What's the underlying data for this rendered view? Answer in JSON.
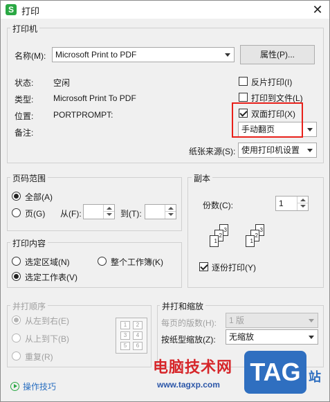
{
  "window": {
    "title": "打印",
    "icon_letter": "S",
    "close_glyph": "✕"
  },
  "printer": {
    "group_title": "打印机",
    "name_label": "名称(M):",
    "name_value": "Microsoft Print to PDF",
    "properties_button": "属性(P)...",
    "status_label": "状态:",
    "status_value": "空闲",
    "type_label": "类型:",
    "type_value": "Microsoft Print To PDF",
    "location_label": "位置:",
    "location_value": "PORTPROMPT:",
    "comment_label": "备注:",
    "reverse_print": {
      "label": "反片打印(I)",
      "checked": false
    },
    "print_to_file": {
      "label": "打印到文件(L)",
      "checked": false
    },
    "duplex": {
      "label": "双面打印(X)",
      "checked": true
    },
    "duplex_mode": "手动翻页",
    "paper_source_label": "纸张来源(S):",
    "paper_source_value": "使用打印机设置"
  },
  "page_range": {
    "group_title": "页码范围",
    "all_label": "全部(A)",
    "pages_label": "页(G)",
    "from_label": "从(F):",
    "to_label": "到(T):"
  },
  "copies": {
    "group_title": "副本",
    "count_label": "份数(C):",
    "count_value": "1",
    "collate": {
      "label": "逐份打印(Y)",
      "checked": true
    },
    "page_numbers": [
      "1",
      "2",
      "3"
    ]
  },
  "print_content": {
    "group_title": "打印内容",
    "selection_label": "选定区域(N)",
    "workbook_label": "整个工作簿(K)",
    "sheet_label": "选定工作表(V)"
  },
  "print_order": {
    "group_title": "并打顺序",
    "left_to_right": "从左到右(E)",
    "top_to_bottom": "从上到下(B)",
    "repeat": "重复(R)",
    "grid_numbers": [
      "1",
      "2",
      "3",
      "4",
      "5",
      "6"
    ]
  },
  "scaling": {
    "group_title": "并打和缩放",
    "pages_per_sheet_label": "每页的版数(H):",
    "pages_per_sheet_value": "1 版",
    "scale_label": "按纸型缩放(Z):",
    "scale_value": "无缩放"
  },
  "footer": {
    "tips_link": "操作技巧"
  },
  "watermark": {
    "site_name": "电脑技术网",
    "url": "www.tagxp.com",
    "logo": "TAG",
    "suffix": "站"
  },
  "colors": {
    "accent_green": "#2aa843",
    "highlight_red": "#e8201a",
    "link_blue": "#2a6fc0"
  }
}
